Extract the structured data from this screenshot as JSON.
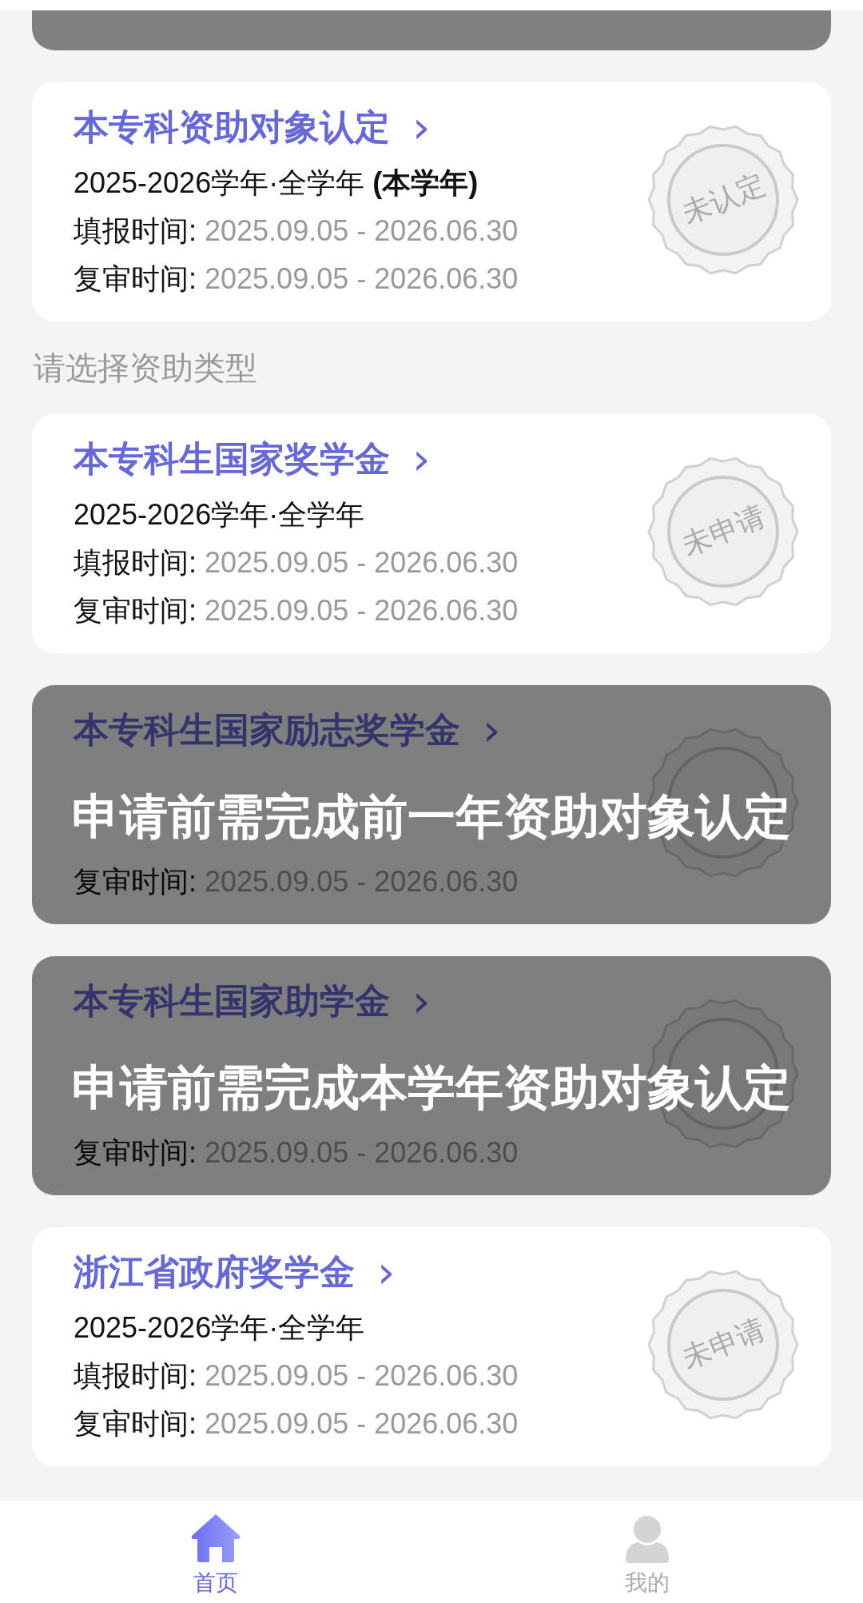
{
  "top_card": {
    "locked": true
  },
  "section_label": "请选择资助类型",
  "cards": [
    {
      "title": "本专科资助对象认定",
      "arrow": "›",
      "period": "2025-2026学年·全学年 **(本学年)**",
      "fill_label": "填报时间:",
      "fill_range": "2025.09.05 - 2026.06.30",
      "review_label": "复审时间:",
      "review_range": "2025.09.05 - 2026.06.30",
      "stamp": "未认定",
      "locked": false
    },
    {
      "title": "本专科生国家奖学金",
      "arrow": "›",
      "period": "2025-2026学年·全学年",
      "fill_label": "填报时间:",
      "fill_range": "2025.09.05 - 2026.06.30",
      "review_label": "复审时间:",
      "review_range": "2025.09.05 - 2026.06.30",
      "stamp": "未申请",
      "locked": false
    },
    {
      "title": "本专科生国家励志奖学金",
      "arrow": "›",
      "review_label": "复审时间:",
      "review_range": "2025.09.05 - 2026.06.30",
      "locked": true,
      "lock_message": "申请前需完成前一年资助对象认定"
    },
    {
      "title": "本专科生国家助学金",
      "arrow": "›",
      "review_label": "复审时间:",
      "review_range": "2025.09.05 - 2026.06.30",
      "locked": true,
      "lock_message": "申请前需完成本学年资助对象认定"
    },
    {
      "title": "浙江省政府奖学金",
      "arrow": "›",
      "period": "2025-2026学年·全学年",
      "fill_label": "填报时间:",
      "fill_range": "2025.09.05 - 2026.06.30",
      "review_label": "复审时间:",
      "review_range": "2025.09.05 - 2026.06.30",
      "stamp": "未申请",
      "locked": false
    }
  ],
  "tabs": [
    {
      "kind": "home",
      "label": "首页",
      "selected": true
    },
    {
      "kind": "profile",
      "label": "我的",
      "selected": false
    }
  ]
}
